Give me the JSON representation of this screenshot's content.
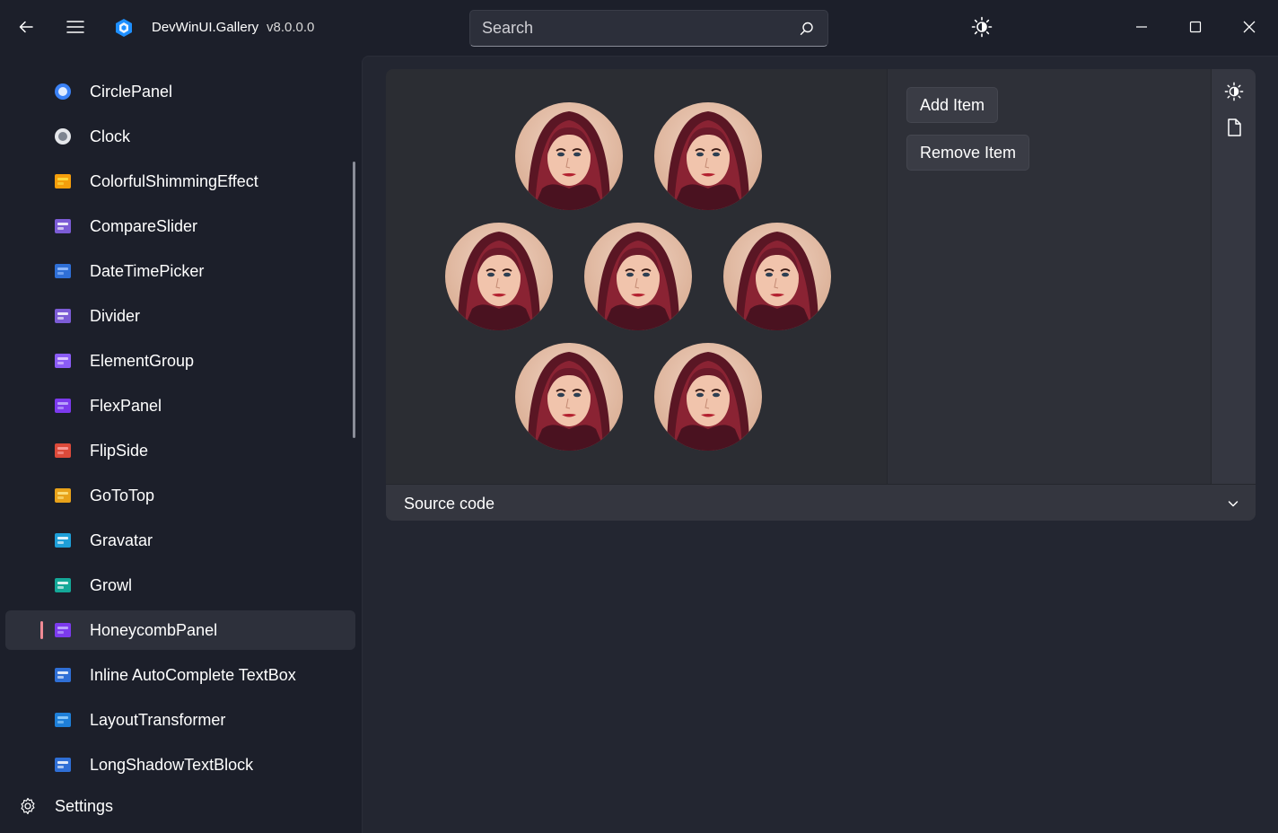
{
  "app": {
    "title": "DevWinUI.Gallery",
    "version": "v8.0.0.0"
  },
  "search": {
    "placeholder": "Search",
    "value": ""
  },
  "sidebar": {
    "items": [
      {
        "label": "CirclePanel",
        "icon": "circle-panel-icon"
      },
      {
        "label": "Clock",
        "icon": "clock-icon"
      },
      {
        "label": "ColorfulShimmingEffect",
        "icon": "shimmer-icon"
      },
      {
        "label": "CompareSlider",
        "icon": "compare-slider-icon"
      },
      {
        "label": "DateTimePicker",
        "icon": "datetime-picker-icon"
      },
      {
        "label": "Divider",
        "icon": "divider-icon"
      },
      {
        "label": "ElementGroup",
        "icon": "element-group-icon"
      },
      {
        "label": "FlexPanel",
        "icon": "flex-panel-icon"
      },
      {
        "label": "FlipSide",
        "icon": "flip-side-icon"
      },
      {
        "label": "GoToTop",
        "icon": "go-to-top-icon"
      },
      {
        "label": "Gravatar",
        "icon": "gravatar-icon"
      },
      {
        "label": "Growl",
        "icon": "growl-icon"
      },
      {
        "label": "HoneycombPanel",
        "icon": "honeycomb-panel-icon",
        "selected": true
      },
      {
        "label": "Inline AutoComplete TextBox",
        "icon": "autocomplete-textbox-icon"
      },
      {
        "label": "LayoutTransformer",
        "icon": "layout-transformer-icon"
      },
      {
        "label": "LongShadowTextBlock",
        "icon": "long-shadow-textblock-icon"
      }
    ],
    "settings_label": "Settings"
  },
  "demo": {
    "add_item_label": "Add Item",
    "remove_item_label": "Remove Item",
    "source_code_label": "Source code",
    "avatar_count": 7
  },
  "colors": {
    "background": "#1c1f2a",
    "content": "#232631",
    "selection_accent": "#f08a94"
  }
}
